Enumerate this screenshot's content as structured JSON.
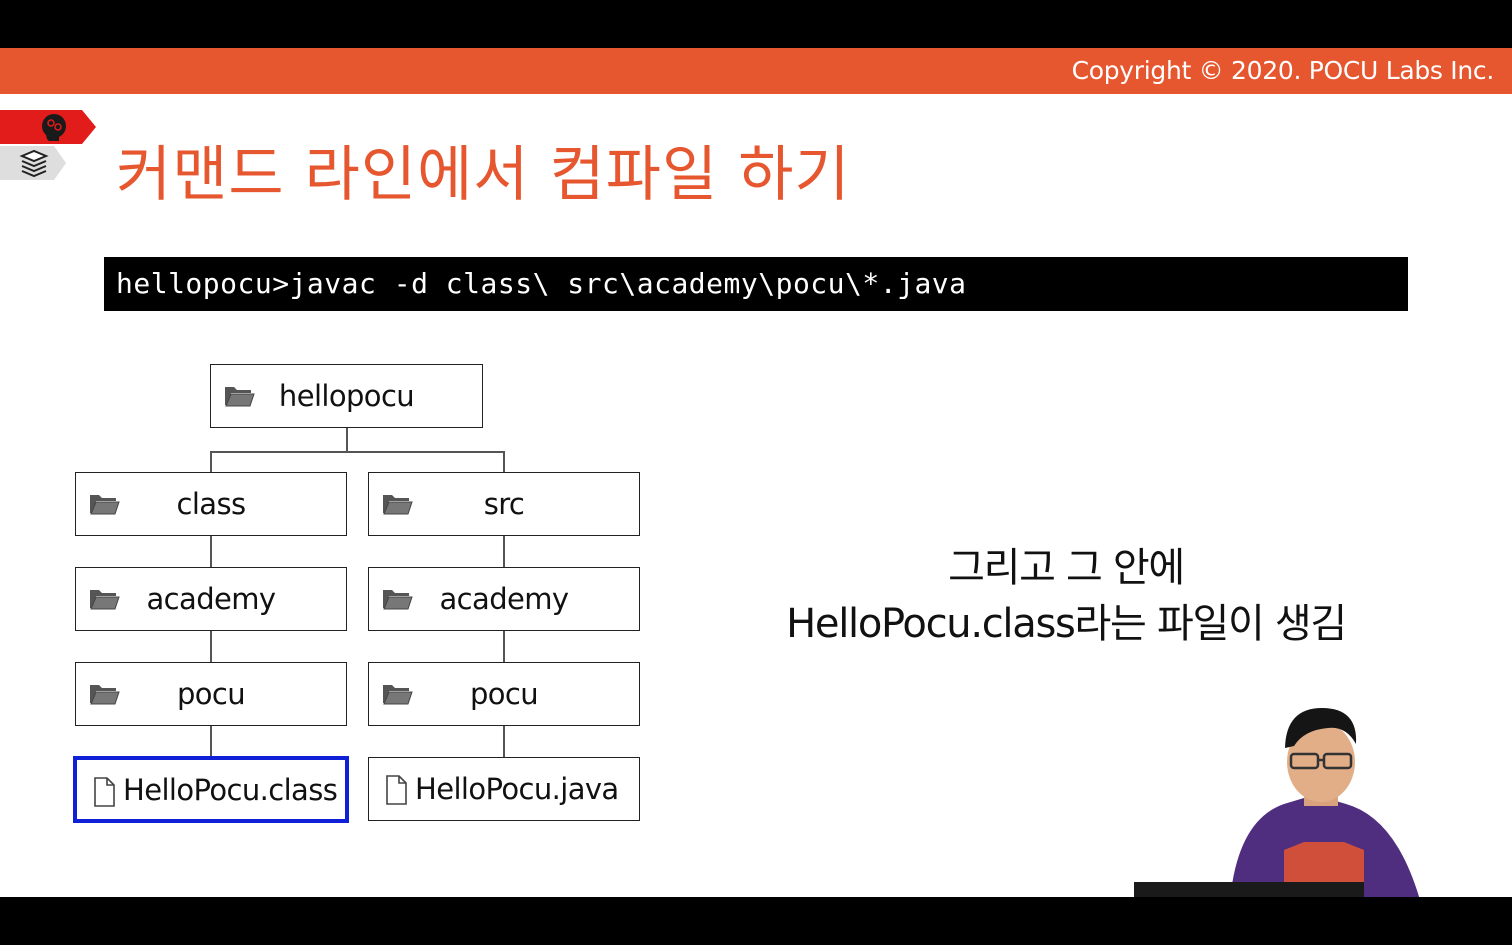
{
  "header": {
    "copyright": "Copyright © 2020. POCU Labs Inc.",
    "accent_color": "#e6562f"
  },
  "badges": {
    "top_icon": "brain-head-icon",
    "bottom_icon": "book-stack-icon"
  },
  "slide": {
    "title": "커맨드 라인에서 컴파일 하기",
    "command": "hellopocu>javac -d class\\ src\\academy\\pocu\\*.java"
  },
  "tree": {
    "root": "hellopocu",
    "left": {
      "dir1": "class",
      "dir2": "academy",
      "dir3": "pocu",
      "file": "HelloPocu.class"
    },
    "right": {
      "dir1": "src",
      "dir2": "academy",
      "dir3": "pocu",
      "file": "HelloPocu.java"
    },
    "highlight_color": "#1020d6"
  },
  "explanation": {
    "line1": "그리고 그 안에",
    "line2": "HelloPocu.class라는 파일이 생김"
  }
}
